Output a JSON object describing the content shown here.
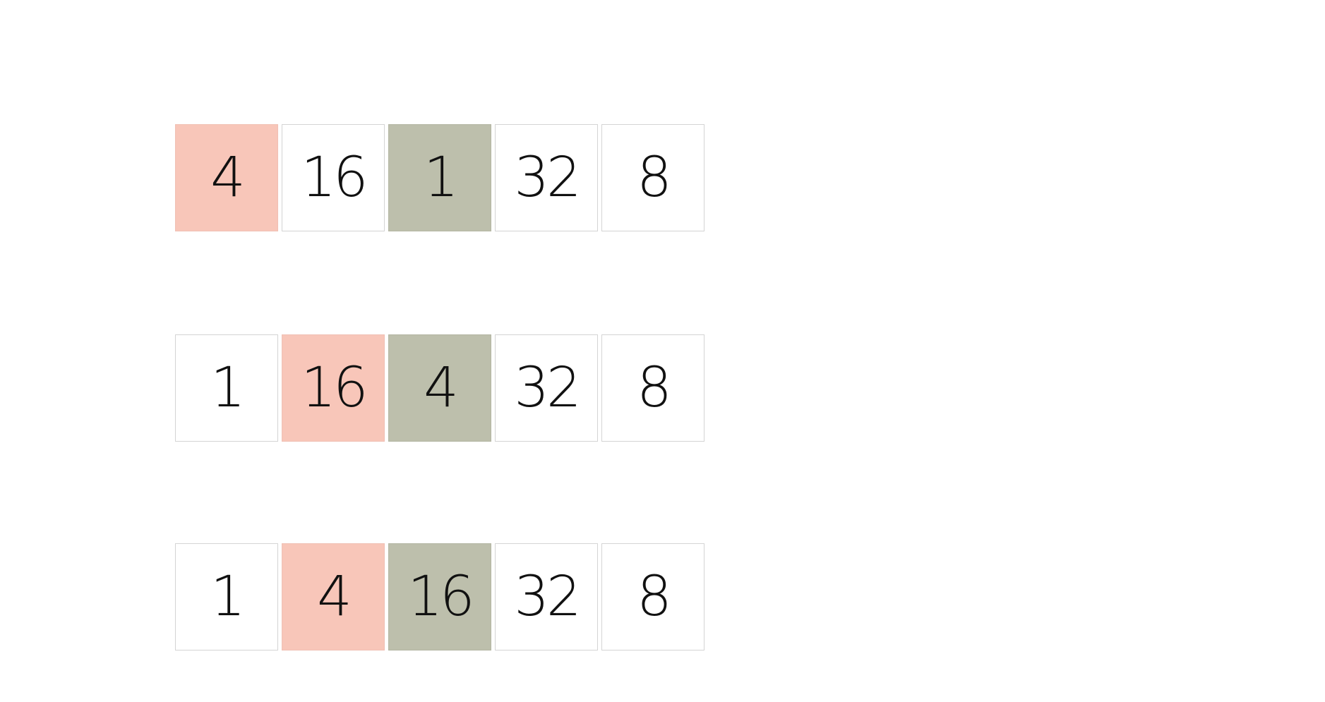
{
  "colors": {
    "highlight_pink": "#f8c6b9",
    "highlight_green": "#bdbfac",
    "plain": "#ffffff"
  },
  "rows": [
    {
      "cells": [
        {
          "value": "4",
          "highlight": "pink"
        },
        {
          "value": "16",
          "highlight": "none"
        },
        {
          "value": "1",
          "highlight": "green"
        },
        {
          "value": "32",
          "highlight": "none"
        },
        {
          "value": "8",
          "highlight": "none"
        }
      ]
    },
    {
      "cells": [
        {
          "value": "1",
          "highlight": "none"
        },
        {
          "value": "16",
          "highlight": "pink"
        },
        {
          "value": "4",
          "highlight": "green"
        },
        {
          "value": "32",
          "highlight": "none"
        },
        {
          "value": "8",
          "highlight": "none"
        }
      ]
    },
    {
      "cells": [
        {
          "value": "1",
          "highlight": "none"
        },
        {
          "value": "4",
          "highlight": "pink"
        },
        {
          "value": "16",
          "highlight": "green"
        },
        {
          "value": "32",
          "highlight": "none"
        },
        {
          "value": "8",
          "highlight": "none"
        }
      ]
    }
  ]
}
